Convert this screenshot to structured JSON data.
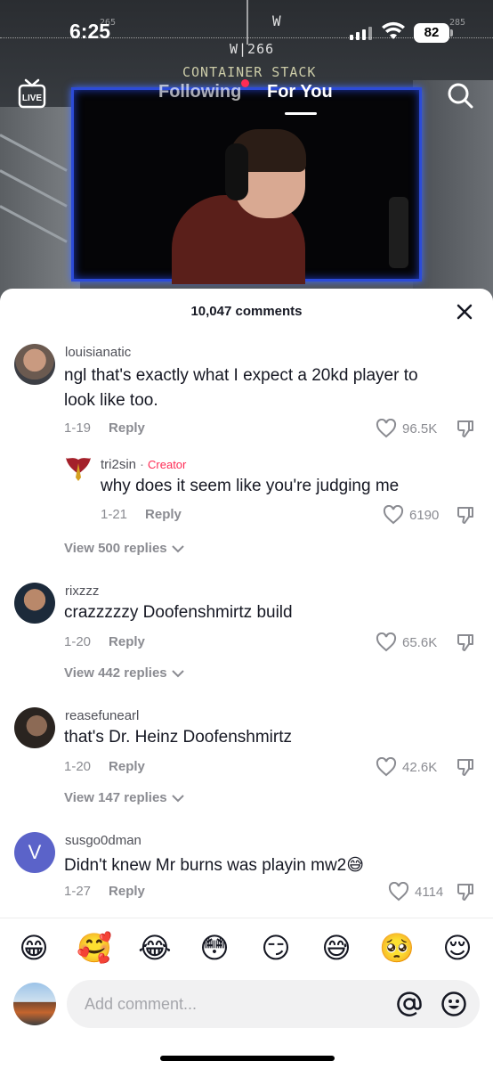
{
  "status_bar": {
    "time": "6:25",
    "battery": "82"
  },
  "hud": {
    "compass": "W",
    "heading": "W|266",
    "left_num": "265",
    "right_num": "285",
    "label": "CONTAINER STACK"
  },
  "nav": {
    "live": "LIVE",
    "tabs": [
      "Following",
      "For You"
    ],
    "active_tab": "For You"
  },
  "sheet": {
    "title": "10,047 comments"
  },
  "comments": [
    {
      "username": "louisianatic",
      "text_lines": [
        "ngl that's exactly what I expect a 20kd player to",
        "look like too."
      ],
      "date": "1-19",
      "reply": "Reply",
      "likes": "96.5K",
      "replies": [
        {
          "username": "tri2sin",
          "badge": "Creator",
          "text": "why does it seem like you're judging me",
          "date": "1-21",
          "reply": "Reply",
          "likes": "6190"
        }
      ],
      "view_replies": "View 500 replies"
    },
    {
      "username": "rixzzz",
      "text_lines": [
        "crazzzzzy Doofenshmirtz build"
      ],
      "date": "1-20",
      "reply": "Reply",
      "likes": "65.6K",
      "view_replies": "View 442 replies"
    },
    {
      "username": "reasefunearl",
      "text_lines": [
        "that's Dr. Heinz Doofenshmirtz"
      ],
      "date": "1-20",
      "reply": "Reply",
      "likes": "42.6K",
      "view_replies": "View 147 replies"
    },
    {
      "username": "susgo0dman",
      "avatar_letter": "V",
      "text_lines": [
        "Didn't knew Mr burns was playin mw2😅"
      ],
      "date": "1-27",
      "reply": "Reply",
      "likes": "4114"
    }
  ],
  "emoji_bar": [
    "😁",
    "🥰",
    "😂",
    "😳",
    "😏",
    "😅",
    "🥺",
    "😌"
  ],
  "input": {
    "placeholder": "Add comment..."
  },
  "colors": {
    "accent": "#fe2c55",
    "text": "#161823",
    "muted": "#8a8b91",
    "avatar_v": "#5b63c9"
  },
  "icons": [
    "live-icon",
    "search-icon",
    "close-icon",
    "heart-icon",
    "dislike-icon",
    "chevron-down-icon",
    "at-icon",
    "emoji-icon"
  ]
}
